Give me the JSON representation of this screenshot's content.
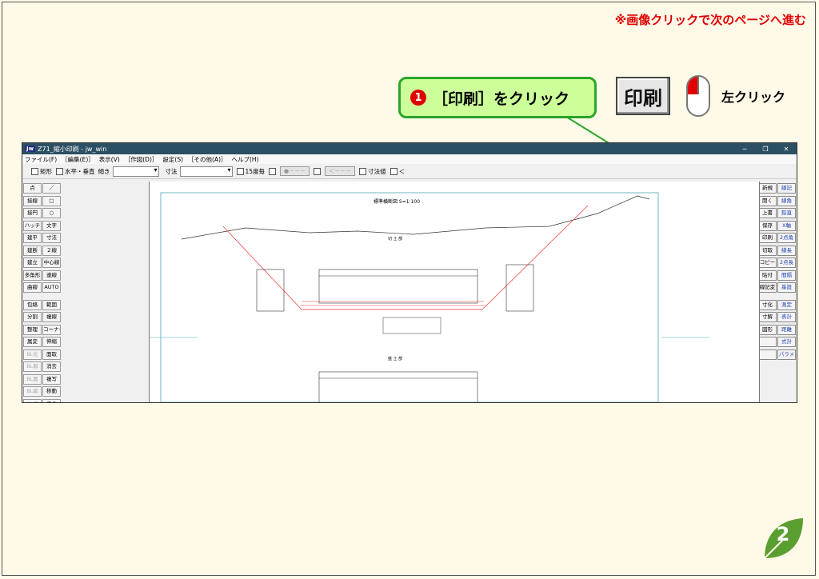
{
  "nav_note": "※画像クリックで次のページへ進む",
  "callout": {
    "number": "1",
    "text": "［印刷］をクリック"
  },
  "big_button_label": "印刷",
  "left_click_label": "左クリック",
  "page_number": "2",
  "colors": {
    "callout_bg": "#ccff99",
    "callout_border": "#2aa52a",
    "accent_red": "#e00000",
    "page_leaf": "#5a9e2f"
  },
  "window": {
    "title": "Z71_縮小印刷 - jw_win",
    "logo": "Jw",
    "controls": [
      "─",
      "❐",
      "✕"
    ],
    "menu": [
      "ファイル(F)",
      "［編集(E)］",
      "表示(V)",
      "［作図(D)］",
      "設定(S)",
      "［その他(A)］",
      "ヘルプ(H)"
    ],
    "toolbar": {
      "rect_label": "矩形",
      "hv_label": "水平・垂直",
      "tilt_label": "傾き",
      "dim_label": "寸法",
      "deg15_label": "15度毎",
      "btn1": "●－－－",
      "btn2": "＜－－－",
      "dimval_label": "寸法値",
      "lt_label": "＜"
    },
    "left_tools": [
      "点",
      "／",
      "接線",
      "□",
      "接円",
      "○",
      "ハッチ",
      "文字",
      "建平",
      "寸法",
      "建断",
      "２線",
      "建立",
      "中心線",
      "多角形",
      "連線",
      "曲線",
      "AUTO",
      "包絡",
      "範囲",
      "分割",
      "複線",
      "整理",
      "コーナー",
      "属変",
      "伸縮",
      "BL化",
      "面取",
      "BL解",
      "消去",
      "BL属",
      "複写",
      "BL編",
      "移動",
      "BL終",
      "戻る"
    ],
    "right_tools": [
      "新規",
      "線記",
      "開く",
      "線角",
      "上書",
      "鉛直",
      "保存",
      "X軸",
      "印刷",
      "2点角",
      "切取",
      "線長",
      "コピー",
      "2点長",
      "貼付",
      "間隔",
      "線記変",
      "基設",
      "寸化",
      "測定",
      "寸解",
      "表計",
      "図形",
      "距離",
      "",
      "式計",
      "",
      "パラメ"
    ],
    "drawing": {
      "section_title": "標準横断図 S=1:100",
      "label_a": "切 土 部",
      "label_b": "盛 土 部"
    }
  }
}
